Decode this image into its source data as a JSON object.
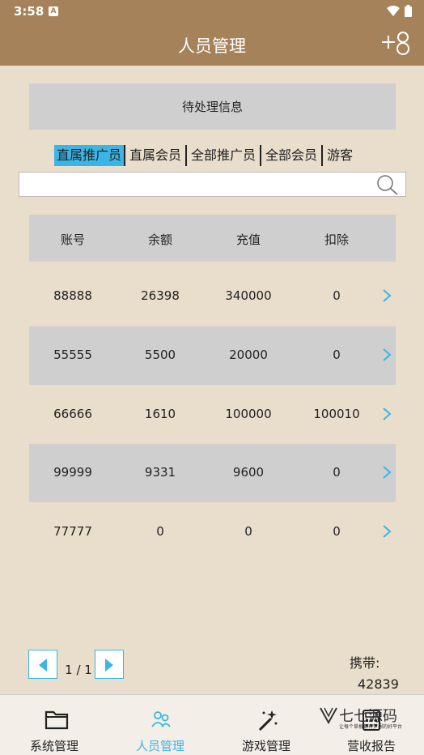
{
  "status_bar": {
    "time": "3:58",
    "notif_letter": "A"
  },
  "header": {
    "title": "人员管理"
  },
  "pending": {
    "label": "待处理信息"
  },
  "tabs": [
    {
      "label": "直属推广员",
      "active": true
    },
    {
      "label": "直属会员",
      "active": false
    },
    {
      "label": "全部推广员",
      "active": false
    },
    {
      "label": "全部会员",
      "active": false
    },
    {
      "label": "游客",
      "active": false
    }
  ],
  "search": {
    "placeholder": "",
    "value": ""
  },
  "table": {
    "headers": [
      "账号",
      "余额",
      "充值",
      "扣除"
    ],
    "rows": [
      [
        "88888",
        "26398",
        "340000",
        "0"
      ],
      [
        "55555",
        "5500",
        "20000",
        "0"
      ],
      [
        "66666",
        "1610",
        "100000",
        "100010"
      ],
      [
        "99999",
        "9331",
        "9600",
        "0"
      ],
      [
        "77777",
        "0",
        "0",
        "0"
      ]
    ]
  },
  "pager": {
    "info": "1 / 1"
  },
  "carry": {
    "label": "携带:",
    "value": "42839"
  },
  "nav": [
    {
      "label": "系统管理",
      "icon": "folder-icon",
      "active": false
    },
    {
      "label": "人员管理",
      "icon": "people-icon",
      "active": true
    },
    {
      "label": "游戏管理",
      "icon": "magic-wand-icon",
      "active": false
    },
    {
      "label": "营收报告",
      "icon": "calculator-icon",
      "active": false
    }
  ],
  "watermark": {
    "text": "七七源码",
    "sub": "让每个草根都有梦想的好平台"
  },
  "colors": {
    "topbar": "#a6825a",
    "accent": "#3ab5e6",
    "background": "#e9ddcb",
    "row_gray": "#cfcfcf"
  }
}
